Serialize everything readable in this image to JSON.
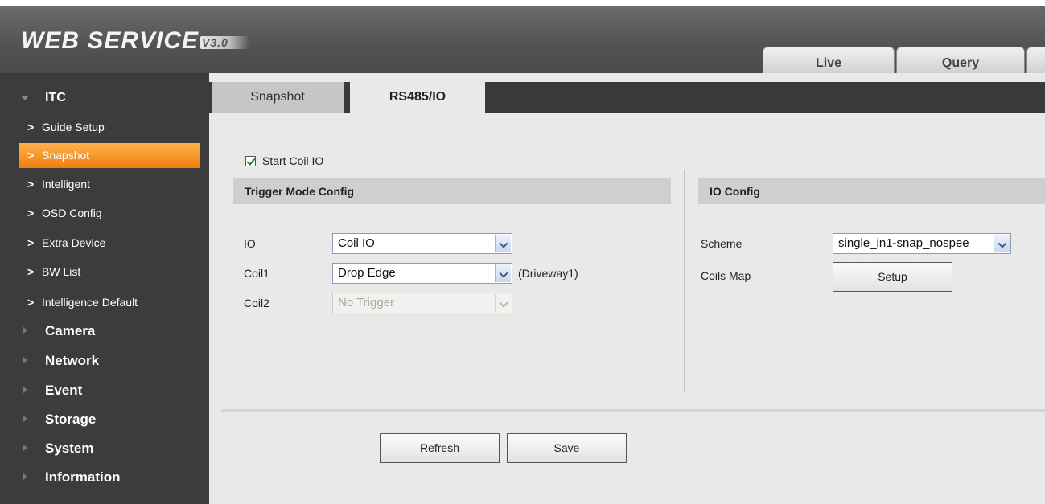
{
  "header": {
    "logo_text": "WEB  SERVICE",
    "logo_version": "V3.0",
    "tabs": [
      {
        "label": "Live"
      },
      {
        "label": "Query"
      },
      {
        "label": ""
      }
    ]
  },
  "sidebar": {
    "itc_label": "ITC",
    "itc_items": [
      {
        "label": "Guide Setup"
      },
      {
        "label": "Snapshot"
      },
      {
        "label": "Intelligent"
      },
      {
        "label": "OSD Config"
      },
      {
        "label": "Extra Device"
      },
      {
        "label": "BW List"
      },
      {
        "label": "Intelligence Default"
      }
    ],
    "sections": [
      {
        "label": "Camera"
      },
      {
        "label": "Network"
      },
      {
        "label": "Event"
      },
      {
        "label": "Storage"
      },
      {
        "label": "System"
      },
      {
        "label": "Information"
      }
    ],
    "active_item": "Snapshot",
    "active_color": "#f28a1c"
  },
  "subtabs": [
    {
      "label": "Snapshot"
    },
    {
      "label": "RS485/IO"
    }
  ],
  "form": {
    "start_coil_io_label": "Start Coil IO",
    "start_coil_io_checked": true,
    "trigger_mode": {
      "title": "Trigger Mode Config",
      "io_label": "IO",
      "io_value": "Coil IO",
      "coil1_label": "Coil1",
      "coil1_value": "Drop Edge",
      "coil1_note": "(Driveway1)",
      "coil2_label": "Coil2",
      "coil2_value": "No Trigger"
    },
    "io_config": {
      "title": "IO Config",
      "scheme_label": "Scheme",
      "scheme_value": "single_in1-snap_nospee",
      "coils_map_label": "Coils Map",
      "setup_button": "Setup"
    }
  },
  "actions": {
    "refresh": "Refresh",
    "save": "Save"
  }
}
